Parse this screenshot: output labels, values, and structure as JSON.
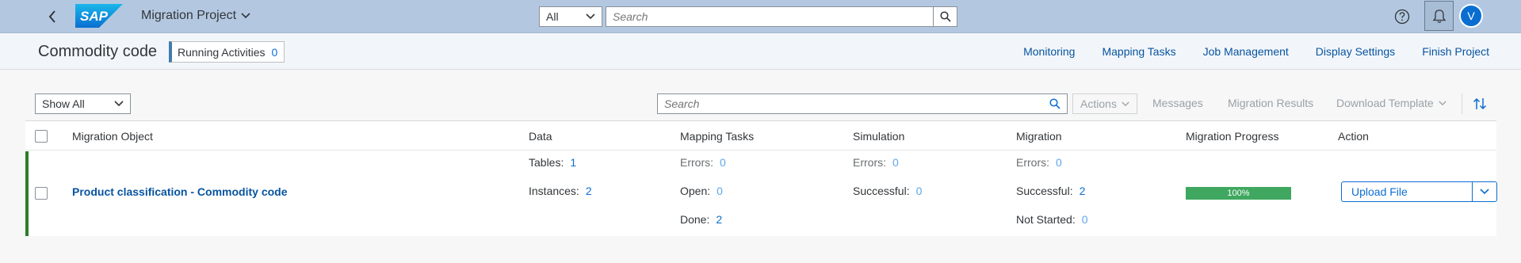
{
  "shell": {
    "logo_text": "SAP",
    "app_title": "Migration Project",
    "scope_value": "All",
    "search_placeholder": "Search",
    "avatar_initial": "V"
  },
  "header": {
    "title": "Commodity code",
    "running_label": "Running Activities",
    "running_count": "0",
    "nav": [
      "Monitoring",
      "Mapping Tasks",
      "Job Management",
      "Display Settings",
      "Finish Project"
    ]
  },
  "toolbar": {
    "filter_value": "Show All",
    "search_placeholder": "Search",
    "actions_label": "Actions",
    "messages_label": "Messages",
    "results_label": "Migration Results",
    "download_label": "Download Template"
  },
  "columns": [
    "Migration Object",
    "Data",
    "Mapping Tasks",
    "Simulation",
    "Migration",
    "Migration Progress",
    "Action"
  ],
  "row": {
    "object_name": "Product classification - Commodity code",
    "data": {
      "tables_label": "Tables:",
      "tables_value": "1",
      "instances_label": "Instances:",
      "instances_value": "2"
    },
    "mapping": {
      "errors_label": "Errors:",
      "errors_value": "0",
      "open_label": "Open:",
      "open_value": "0",
      "done_label": "Done:",
      "done_value": "2"
    },
    "simulation": {
      "errors_label": "Errors:",
      "errors_value": "0",
      "successful_label": "Successful:",
      "successful_value": "0"
    },
    "migration": {
      "errors_label": "Errors:",
      "errors_value": "0",
      "successful_label": "Successful:",
      "successful_value": "2",
      "not_started_label": "Not Started:",
      "not_started_value": "0"
    },
    "progress": "100%",
    "progress_fraction": 1.0,
    "action_label": "Upload File"
  },
  "colors": {
    "shell_bg": "#b3c8e0",
    "link": "#0a6ed1",
    "success": "#3fa75f",
    "row_indicator": "#2b7d2b"
  }
}
